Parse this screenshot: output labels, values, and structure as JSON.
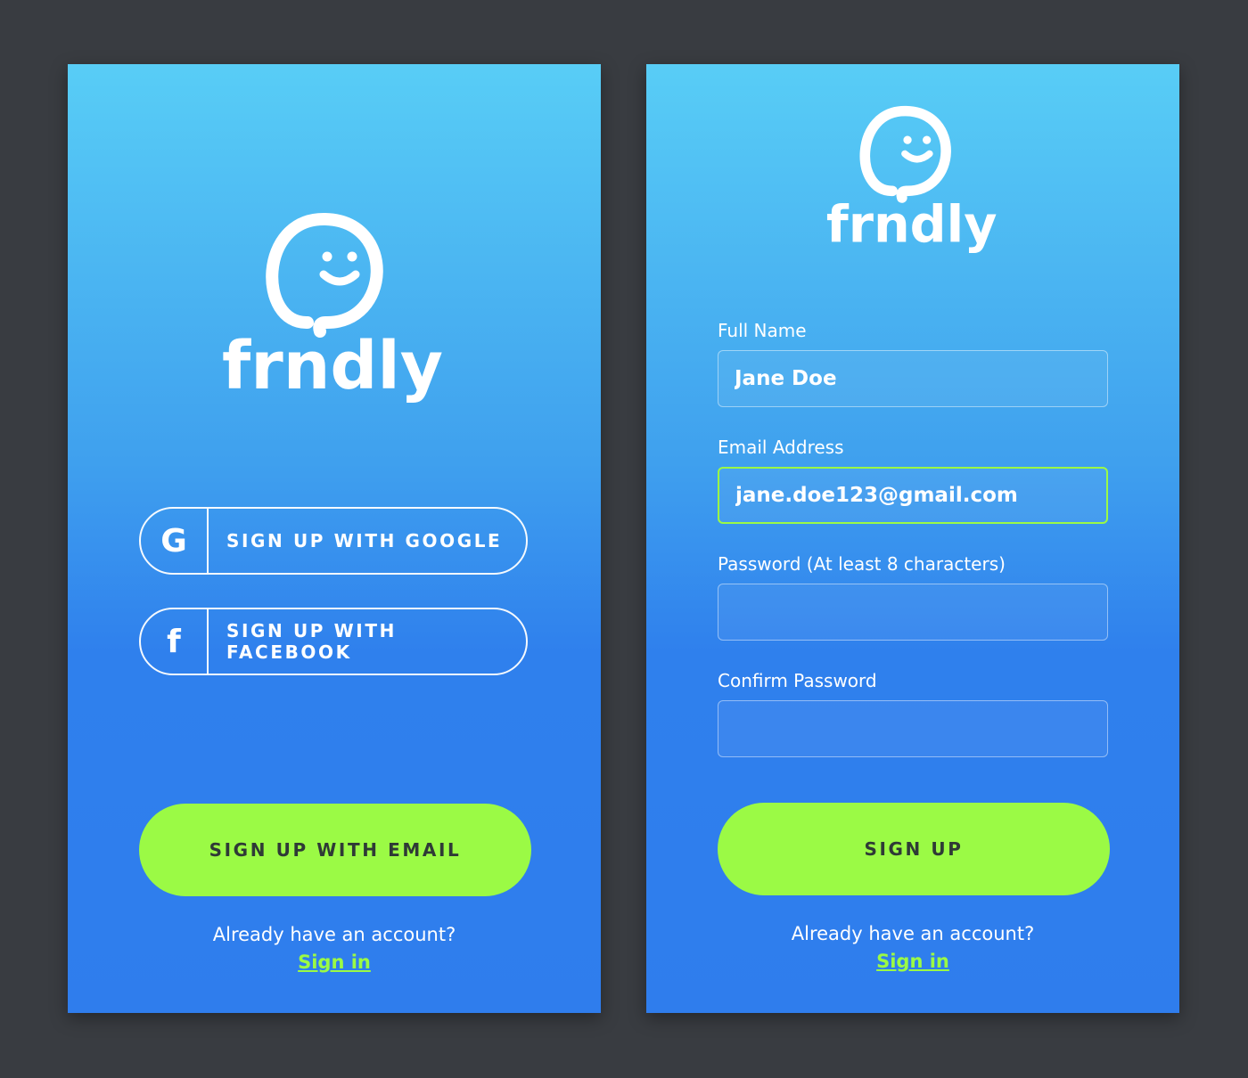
{
  "colors": {
    "background": "#393c41",
    "gradient_top": "#58cdf6",
    "gradient_bottom": "#2f7ded",
    "accent": "#9bfa45",
    "button_text": "#2f3a36",
    "text": "#ffffff"
  },
  "left_screen": {
    "logo": {
      "icon": "smiley-speech-bubble-icon",
      "wordmark": "frndly"
    },
    "google_button": {
      "icon": "google-icon",
      "icon_glyph": "G",
      "label": "SIGN UP WITH GOOGLE"
    },
    "facebook_button": {
      "icon": "facebook-icon",
      "icon_glyph": "f",
      "label": "SIGN UP WITH FACEBOOK"
    },
    "email_button": {
      "label": "SIGN UP WITH EMAIL"
    },
    "footer": {
      "prompt": "Already have an account?",
      "link": "Sign in"
    }
  },
  "right_screen": {
    "logo": {
      "icon": "smiley-speech-bubble-icon",
      "wordmark": "frndly"
    },
    "form": {
      "full_name": {
        "label": "Full Name",
        "value": "Jane Doe"
      },
      "email": {
        "label": "Email Address",
        "value": "jane.doe123@gmail.com"
      },
      "password": {
        "label": "Password (At least 8 characters)",
        "value": ""
      },
      "confirm_password": {
        "label": "Confirm Password",
        "value": ""
      }
    },
    "submit_button": {
      "label": "SIGN UP"
    },
    "footer": {
      "prompt": "Already have an account?",
      "link": "Sign in"
    }
  }
}
